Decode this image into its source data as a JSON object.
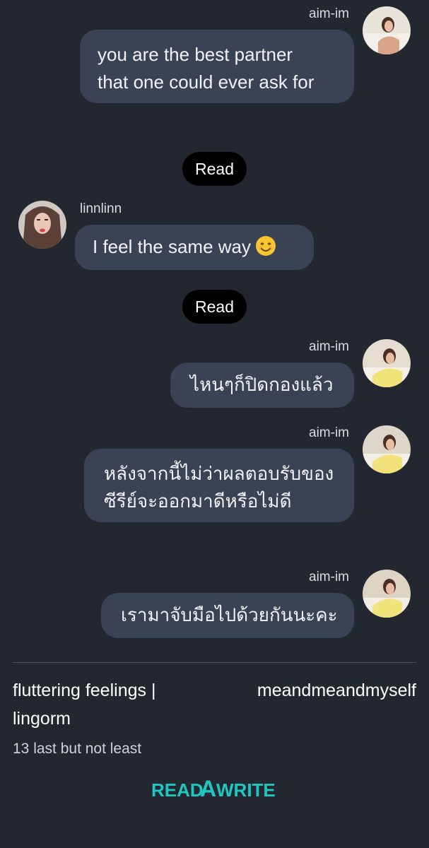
{
  "messages": [
    {
      "sender": "aim-im",
      "lines": [
        "you are the best partner",
        "that one could ever ask for"
      ]
    },
    {
      "status": "Read"
    },
    {
      "sender": "linnlinn",
      "text": "I feel the same way"
    },
    {
      "status": "Read"
    },
    {
      "sender": "aim-im",
      "text": "ไหนๆก็ปิดกองแล้ว"
    },
    {
      "sender": "aim-im",
      "lines": [
        "หลังจากนี้ไม่ว่าผลตอบรับของ",
        "ซีรีย์จะออกมาดีหรือไม่ดี"
      ]
    },
    {
      "sender": "aim-im",
      "text": "เรามาจับมือไปด้วยกันนะคะ"
    }
  ],
  "story": {
    "title_line1": "fluttering feelings |",
    "title_line2": "lingorm",
    "author": "meandmeandmyself",
    "chapter": "13 last but not least"
  },
  "logo": {
    "text_left": "READ",
    "text_a": "A",
    "text_right": "WRITE"
  },
  "colors": {
    "background": "#23272f",
    "bubble": "#3a4354",
    "read_pill": "#000000",
    "brand": "#1fc7c2"
  },
  "icons": {
    "emoji": "smiling-face-icon"
  }
}
